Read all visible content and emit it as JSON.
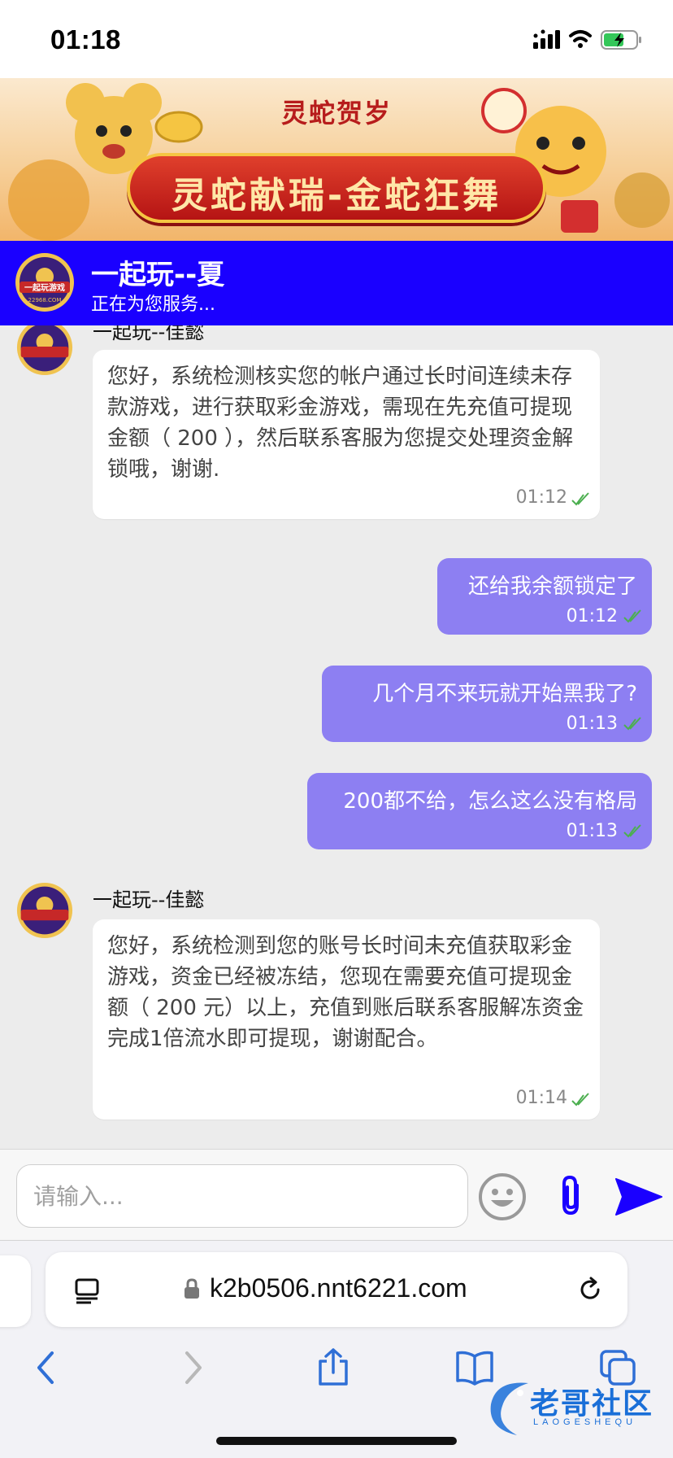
{
  "status_bar": {
    "time": "01:18",
    "icons": [
      "signal-icon",
      "wifi-icon",
      "battery-charging-icon"
    ]
  },
  "banner": {
    "small_title": "灵蛇贺岁",
    "main_title": "灵蛇献瑞-金蛇狂舞",
    "logo_text": "一起玩游戏",
    "logo_domain": "22968.COM"
  },
  "header": {
    "agent_name": "一起玩--夏",
    "status": "正在为您服务..."
  },
  "messages": [
    {
      "direction": "in",
      "sender": "一起玩--佳懿",
      "text": "您好，系统检测核实您的帐户通过长时间连续未存款游戏，进行获取彩金游戏，需现在先充值可提现金额（ 200 ），然后联系客服为您提交处理资金解锁哦，谢谢.",
      "time": "01:12",
      "read": true
    },
    {
      "direction": "out",
      "text": "还给我余额锁定了",
      "time": "01:12",
      "read": true
    },
    {
      "direction": "out",
      "text": "几个月不来玩就开始黑我了?",
      "time": "01:13",
      "read": true
    },
    {
      "direction": "out",
      "text": "200都不给，怎么这么没有格局",
      "time": "01:13",
      "read": true
    },
    {
      "direction": "in",
      "sender": "一起玩--佳懿",
      "text": "您好，系统检测到您的账号长时间未充值获取彩金游戏，资金已经被冻结，您现在需要充值可提现金额（  200 元）以上，充值到账后联系客服解冻资金完成1倍流水即可提现，谢谢配合。",
      "time": "01:14",
      "read": true
    }
  ],
  "composer": {
    "placeholder": "请输入..."
  },
  "browser": {
    "url": "k2b0506.nnt6221.com"
  },
  "watermark": {
    "text": "老哥社区",
    "sub": "LAOGESHEQU"
  },
  "colors": {
    "header_bg": "#1a00ff",
    "outgoing_bubble": "#8d7ff2",
    "send_icon": "#1a00ff",
    "check": "#4caf50"
  }
}
